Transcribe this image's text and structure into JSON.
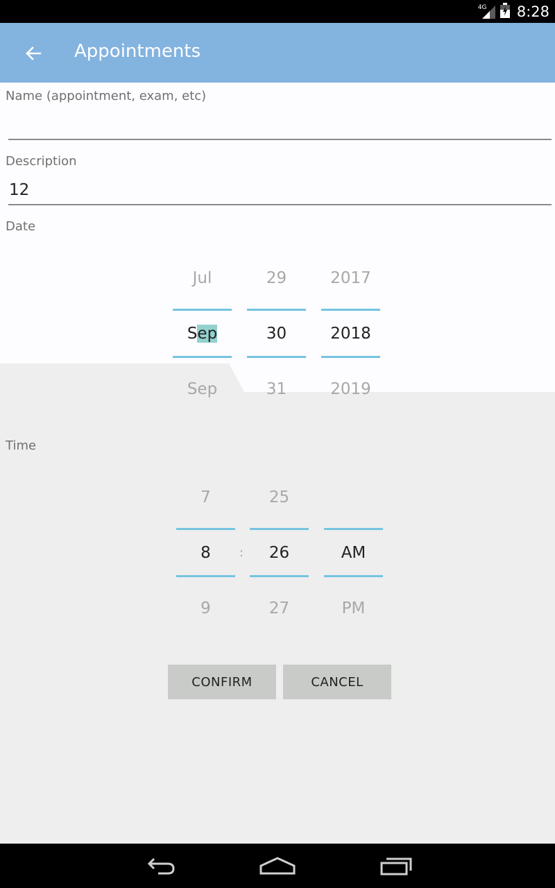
{
  "status_bar": {
    "network": "4G",
    "time": "8:28"
  },
  "app_bar": {
    "title": "Appointments"
  },
  "form": {
    "name": {
      "label": "Name (appointment, exam, etc)",
      "value": ""
    },
    "description": {
      "label": "Description",
      "value": "12"
    },
    "date_label": "Date",
    "time_label": "Time"
  },
  "date_picker": {
    "month": {
      "prev": "Jul",
      "current_start": "S",
      "current_highlight": "ep",
      "next": "Sep"
    },
    "day": {
      "prev": "29",
      "current": "30",
      "next": "31"
    },
    "year": {
      "prev": "2017",
      "current": "2018",
      "next": "2019"
    }
  },
  "time_picker": {
    "hour": {
      "prev": "7",
      "current": "8",
      "next": "9"
    },
    "separator": ":",
    "minute": {
      "prev": "25",
      "current": "26",
      "next": "27"
    },
    "ampm": {
      "prev": "",
      "current": "AM",
      "next": "PM"
    }
  },
  "buttons": {
    "confirm": "CONFIRM",
    "cancel": "CANCEL"
  },
  "icons": {
    "back": "arrow-left-icon",
    "signal": "signal-icon",
    "battery": "battery-icon",
    "nav_back": "nav-back-icon",
    "nav_home": "nav-home-icon",
    "nav_recents": "nav-recents-icon"
  },
  "colors": {
    "app_bar": "#83b3df",
    "picker_divider": "#75c4e0",
    "selection_highlight": "#93d1cf",
    "button_bg": "#c8cbc7"
  }
}
